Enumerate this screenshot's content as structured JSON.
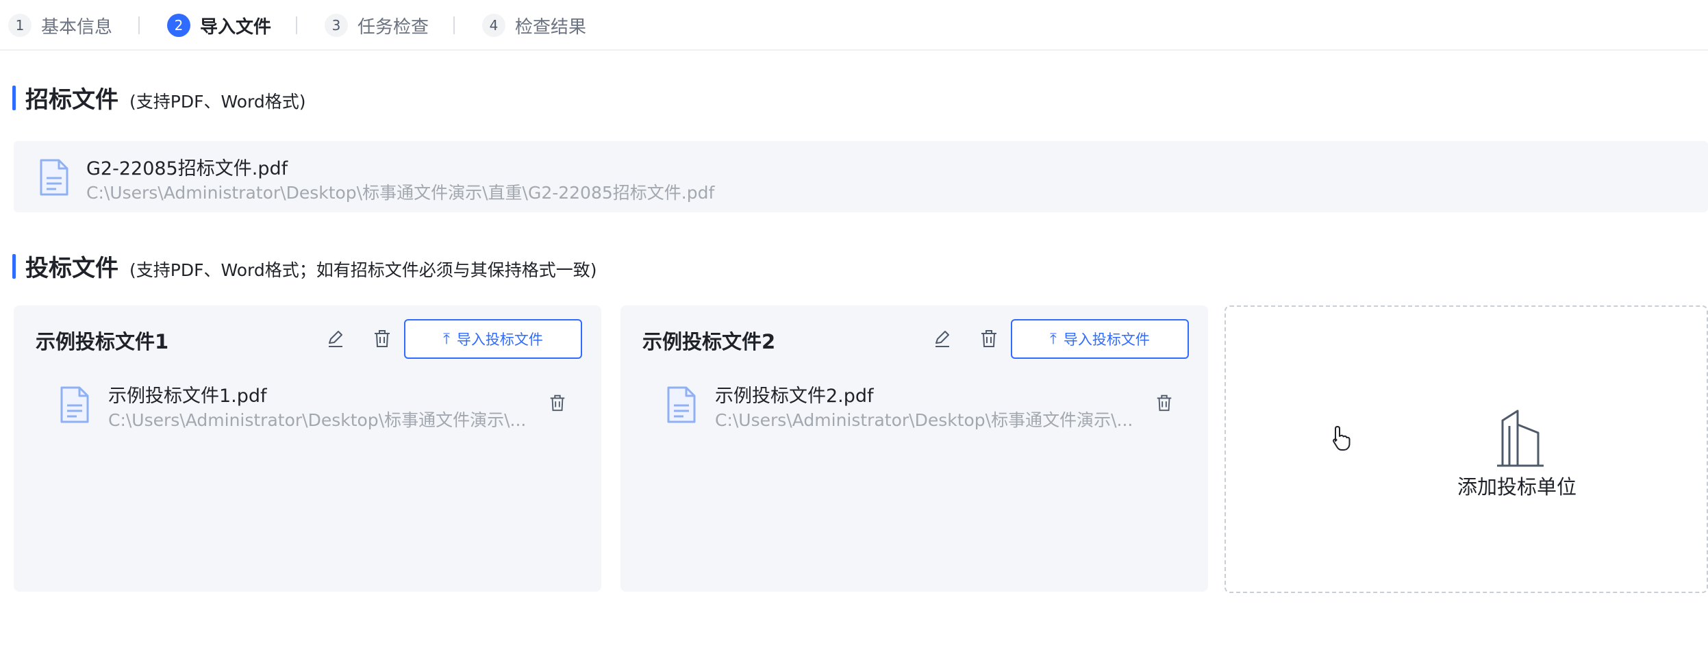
{
  "steps": [
    {
      "num": "1",
      "label": "基本信息"
    },
    {
      "num": "2",
      "label": "导入文件"
    },
    {
      "num": "3",
      "label": "任务检查"
    },
    {
      "num": "4",
      "label": "检查结果"
    }
  ],
  "tender_section": {
    "title": "招标文件",
    "hint": "(支持PDF、Word格式)",
    "file": {
      "name": "G2-22085招标文件.pdf",
      "path": "C:\\Users\\Administrator\\Desktop\\标事通文件演示\\直重\\G2-22085招标文件.pdf"
    }
  },
  "bid_section": {
    "title": "投标文件",
    "hint": "(支持PDF、Word格式；如有招标文件必须与其保持格式一致)",
    "cards": [
      {
        "title": "示例投标文件1",
        "import_label": "导入投标文件",
        "file": {
          "name": "示例投标文件1.pdf",
          "path": "C:\\Users\\Administrator\\Desktop\\标事通文件演示\\..."
        }
      },
      {
        "title": "示例投标文件2",
        "import_label": "导入投标文件",
        "file": {
          "name": "示例投标文件2.pdf",
          "path": "C:\\Users\\Administrator\\Desktop\\标事通文件演示\\..."
        }
      }
    ],
    "add_label": "添加投标单位"
  },
  "colors": {
    "accent": "#2f6bff",
    "card_bg": "#f4f6f9",
    "muted_text": "#a3a8b0"
  },
  "icons": [
    "file-doc-icon",
    "edit-icon",
    "trash-icon",
    "upload-icon",
    "building-icon",
    "pointer-cursor-icon"
  ]
}
